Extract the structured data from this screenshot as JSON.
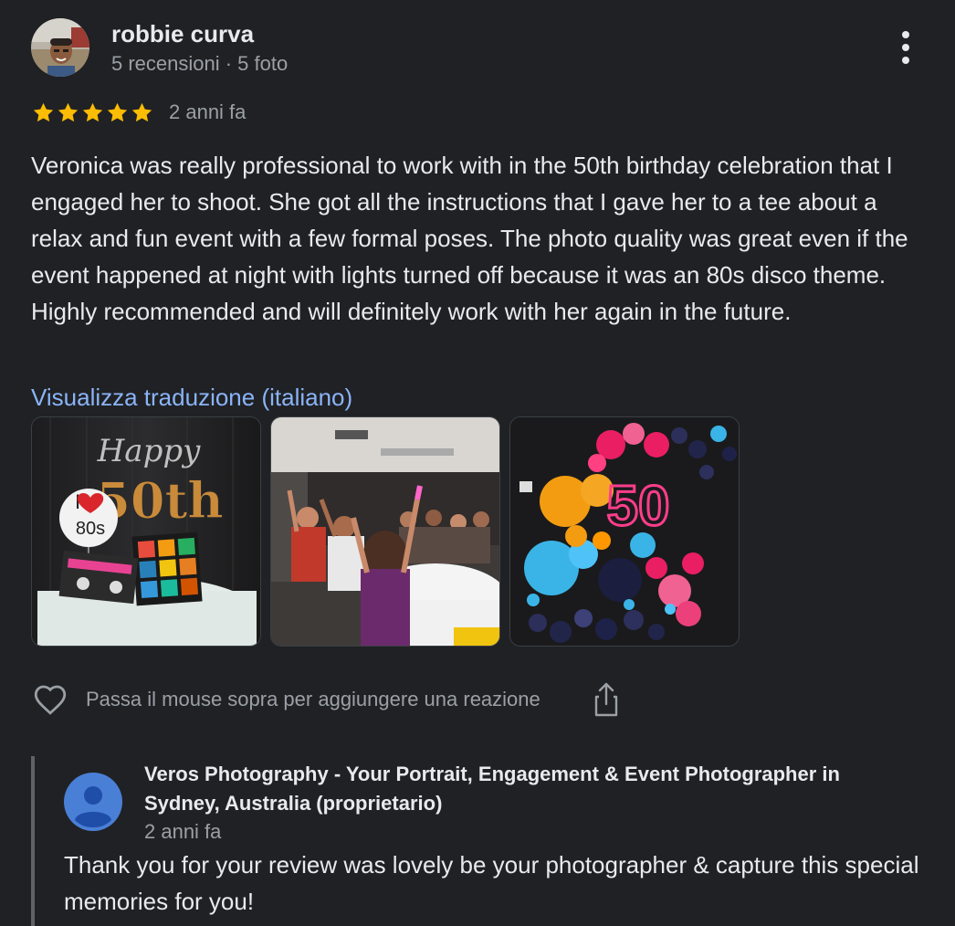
{
  "review": {
    "author_name": "robbie curva",
    "author_meta": "5 recensioni · 5 foto",
    "rating": 5,
    "rating_max": 5,
    "date": "2 anni fa",
    "text": "Veronica was really professional to work with in the 50th birthday celebration that I engaged her to shoot. She got all the instructions that I gave her to a tee about a relax and fun event with a few formal poses. The photo quality was great even if the event happened at night with lights turned off because it was an 80s disco theme. Highly recommended and will definitely work with her again in the future.",
    "translate_link": "Visualizza traduzione (italiano)",
    "photos": [
      {
        "icon": "cake-photo",
        "cake_text_1": "Happy",
        "cake_text_2": "50th",
        "badge_text_1": "I",
        "badge_text_2": "80s"
      },
      {
        "icon": "party-photo"
      },
      {
        "icon": "balloons-photo",
        "neon_text": "50"
      }
    ],
    "reaction_hint": "Passa il mouse sopra per aggiungere una reazione",
    "icons": [
      "more-vert-icon",
      "star-icon",
      "heart-icon",
      "share-icon",
      "person-icon"
    ]
  },
  "owner_reply": {
    "name": "Veros Photography - Your Portrait, Engagement & Event Photographer in Sydney, Australia (proprietario)",
    "date": "2 anni fa",
    "text": "Thank you for your review was lovely be your photographer & capture this special memories for you!"
  },
  "colors": {
    "background": "#202124",
    "star": "#fbbc04",
    "link": "#8ab4f8",
    "secondary_text": "#9aa0a6",
    "owner_avatar": "#4a7fd6"
  }
}
